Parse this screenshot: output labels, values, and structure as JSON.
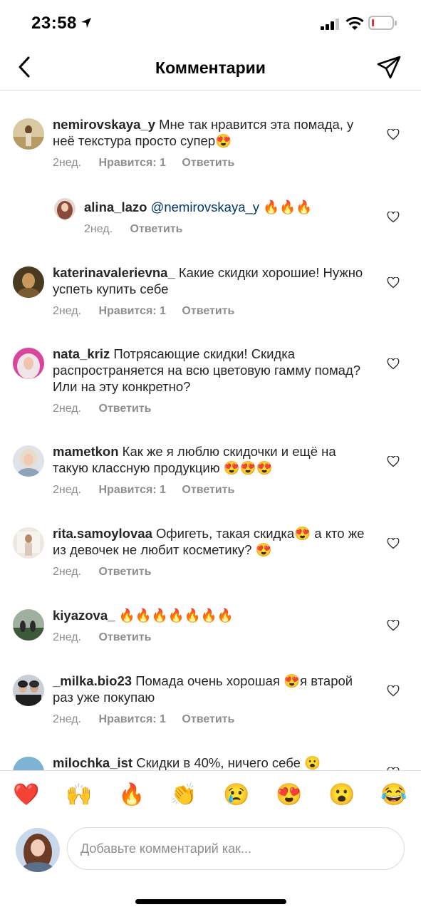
{
  "status_bar": {
    "time": "23:58"
  },
  "header": {
    "title": "Комментарии"
  },
  "comments": [
    {
      "user": "nemirovskaya_y",
      "text": "Мне так нравится эта помада, у неё текстура просто супер😍",
      "time": "2нед.",
      "likes": "Нравится: 1",
      "reply": "Ответить"
    },
    {
      "user": "alina_lazo",
      "mention": "@nemirovskaya_y",
      "text": " 🔥🔥🔥",
      "time": "2нед.",
      "reply": "Ответить"
    },
    {
      "user": "katerinavalerievna_",
      "text": "Какие скидки хорошие! Нужно успеть купить себе",
      "time": "2нед.",
      "likes": "Нравится: 1",
      "reply": "Ответить"
    },
    {
      "user": "nata_kriz",
      "text": "Потрясающие скидки! Скидка распространяется на всю цветовую гамму помад? Или на эту конкретно?",
      "time": "2нед.",
      "reply": "Ответить"
    },
    {
      "user": "mametkon",
      "text": "Как же я люблю скидочки  и ещё на такую классную продукцию 😍😍😍",
      "time": "2нед.",
      "likes": "Нравится: 1",
      "reply": "Ответить"
    },
    {
      "user": "rita.samoylovaa",
      "text": "Офигеть, такая скидка😍 а кто же из девочек не любит косметику? 😍",
      "time": "2нед.",
      "reply": "Ответить"
    },
    {
      "user": "kiyazova_",
      "text": "🔥🔥🔥🔥🔥🔥🔥",
      "time": "2нед.",
      "reply": "Ответить"
    },
    {
      "user": "_milka.bio23",
      "text": "Помада очень хорошая 😍я втарой раз уже покупаю",
      "time": "2нед.",
      "likes": "Нравится: 1",
      "reply": "Ответить"
    },
    {
      "user": "milochka_ist",
      "text": "Скидки в 40%, ничего себе 😮",
      "time": "",
      "reply": ""
    }
  ],
  "quick_emojis": [
    "❤️",
    "🙌",
    "🔥",
    "👏",
    "😢",
    "😍",
    "😮",
    "😂"
  ],
  "input": {
    "placeholder": "Добавьте комментарий как..."
  },
  "icons": {
    "back": "chevron-left-icon",
    "send": "paper-plane-icon",
    "like": "heart-outline-icon",
    "location": "location-arrow-icon",
    "signal": "cellular-signal-icon",
    "wifi": "wifi-icon",
    "battery": "battery-low-icon"
  },
  "colors": {
    "mention": "#00376b",
    "secondary_text": "#8e8e8e",
    "divider": "#dbdbdb",
    "battery_low": "#e0343b"
  }
}
